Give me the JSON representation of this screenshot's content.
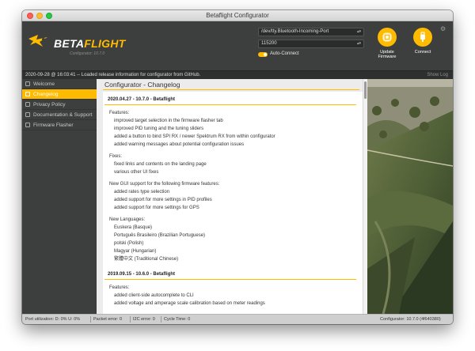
{
  "window": {
    "title": "Betaflight Configurator"
  },
  "header": {
    "logo": {
      "brand_main": "BETA",
      "brand_accent": "FLIGHT",
      "subtitle": "Configurator: 10.7.0"
    },
    "port_select": {
      "value": "/dev/tty.Bluetooth-Incoming-Port"
    },
    "baud_select": {
      "value": "115200"
    },
    "auto_connect": {
      "label": "Auto-Connect",
      "enabled": true
    },
    "update_firmware": {
      "label_line1": "Update",
      "label_line2": "Firmware"
    },
    "connect": {
      "label": "Connect"
    }
  },
  "logbar": {
    "message": "2020-09-28 @ 16:03:41 -- Loaded release information for configurator from GitHub.",
    "show_log": "Show Log"
  },
  "sidebar": {
    "items": [
      {
        "label": "Welcome",
        "active": false
      },
      {
        "label": "Changelog",
        "active": true
      },
      {
        "label": "Privacy Policy",
        "active": false
      },
      {
        "label": "Documentation & Support",
        "active": false
      },
      {
        "label": "Firmware Flasher",
        "active": false
      }
    ]
  },
  "content": {
    "title": "Configurator - Changelog",
    "releases": [
      {
        "header": "2020.04.27 - 10.7.0 - Betaflight",
        "sections": [
          {
            "title": "Features:",
            "items": [
              "improved target selection in the firmware flasher tab",
              "improved PID tuning and the tuning sliders",
              "added a button to bind SPI RX / newer Spektrum RX from within configurator",
              "added warning messages about potential configuration issues"
            ]
          },
          {
            "title": "Fixes:",
            "items": [
              "fixed links and contents on the landing page",
              "various other UI fixes"
            ]
          },
          {
            "title": "New GUI support for the following firmware features:",
            "items": [
              "added rates type selection",
              "added support for more settings in PID profiles",
              "added support for more settings for GPS"
            ]
          },
          {
            "title": "New Languages:",
            "items": [
              "Euskera (Basque)",
              "Português Brasileiro (Brazilian Portuguese)",
              "polski (Polish)",
              "Magyar (Hungarian)",
              "繁體中文 (Traditional Chinese)"
            ]
          }
        ]
      },
      {
        "header": "2019.09.15 - 10.6.0 - Betaflight",
        "sections": [
          {
            "title": "Features:",
            "items": [
              "added client-side autocomplete to CLI",
              "added voltage and amperage scale calibration based on meter readings"
            ]
          }
        ]
      }
    ]
  },
  "statusbar": {
    "port_utilization": "Port utilization: D: 0% U: 0%",
    "packet_error": "Packet error: 0",
    "i2c_error": "I2C error: 0",
    "cycle_time": "Cycle Time: 0",
    "configurator_version": "Configurator: 10.7.0 (4f640380)"
  },
  "colors": {
    "accent": "#ffbb00",
    "header_bg": "#3d3f3e",
    "logbar_bg": "#2e302f"
  }
}
